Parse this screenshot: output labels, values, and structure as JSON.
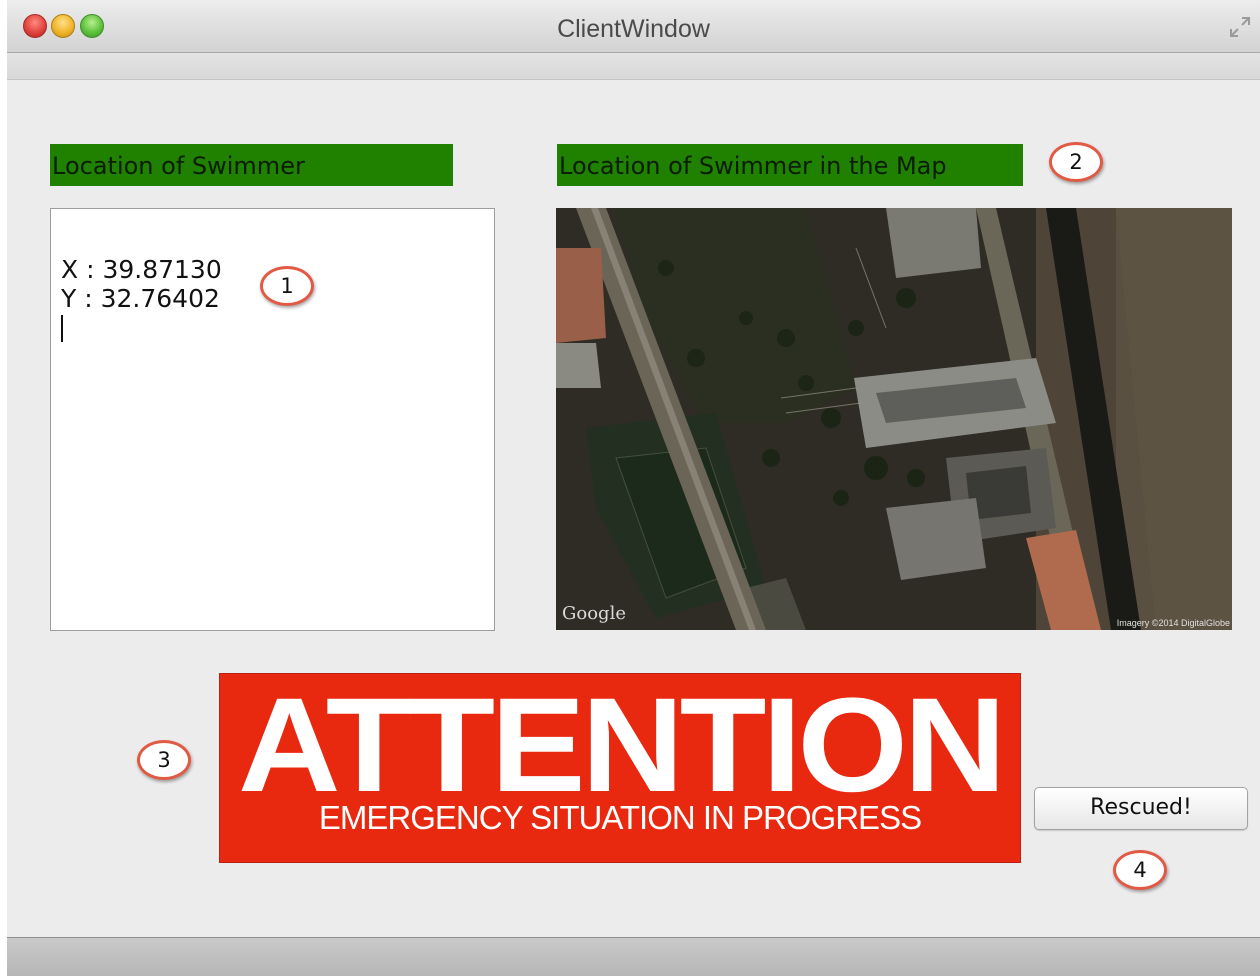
{
  "window": {
    "title": "ClientWindow"
  },
  "location_panel": {
    "label": "Location of Swimmer",
    "x_line": "X : 39.87130",
    "y_line": "Y : 32.76402"
  },
  "map_panel": {
    "label": "Location of Swimmer in the Map",
    "provider": "Google",
    "imagery_credit": "Imagery ©2014 DigitalGlobe"
  },
  "alert": {
    "headline": "ATTENTION",
    "subline": "EMERGENCY SITUATION IN PROGRESS",
    "background_color": "#e8280f"
  },
  "rescue_button": {
    "label": "Rescued!"
  },
  "callouts": [
    "1",
    "2",
    "3",
    "4"
  ],
  "colors": {
    "section_label_bg": "#208000",
    "callout_ring": "#e35a44"
  },
  "icons": [
    "close-icon",
    "minimize-icon",
    "zoom-icon",
    "fullscreen-icon"
  ]
}
